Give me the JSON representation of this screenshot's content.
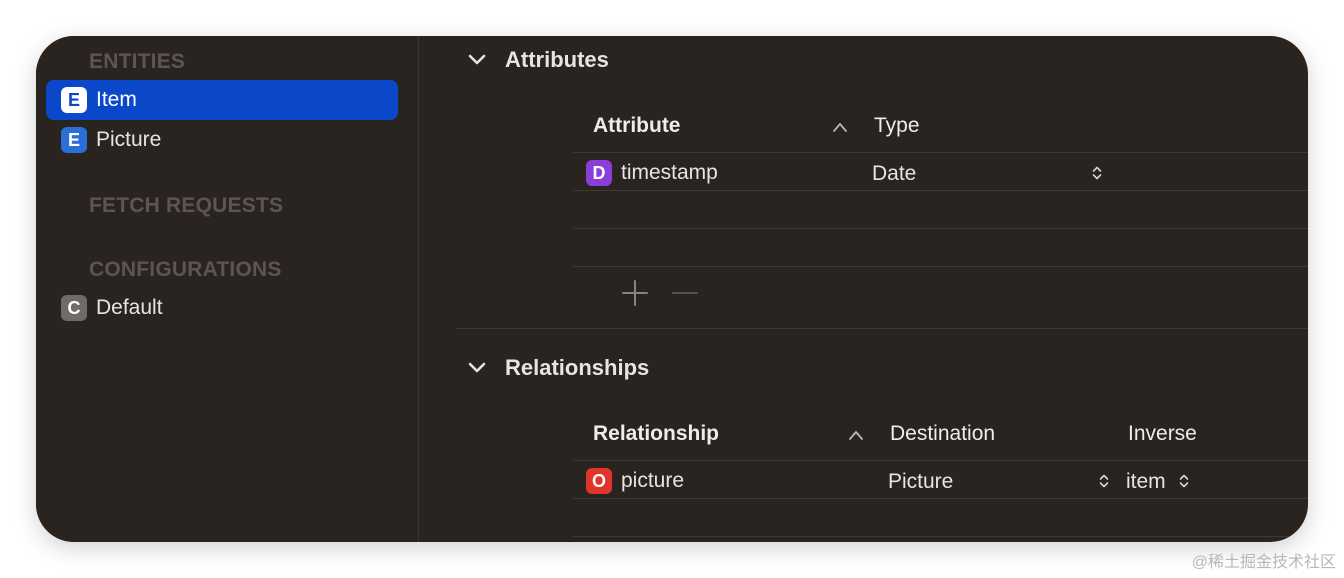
{
  "sidebar": {
    "entities_title": "ENTITIES",
    "entities": [
      {
        "badge": "E",
        "label": "Item",
        "selected": true
      },
      {
        "badge": "E",
        "label": "Picture",
        "selected": false
      }
    ],
    "fetch_requests_title": "FETCH REQUESTS",
    "configurations_title": "CONFIGURATIONS",
    "configurations": [
      {
        "badge": "C",
        "label": "Default"
      }
    ]
  },
  "attributes": {
    "title": "Attributes",
    "columns": {
      "attribute": "Attribute",
      "type": "Type"
    },
    "rows": [
      {
        "badge": "D",
        "name": "timestamp",
        "type": "Date"
      }
    ]
  },
  "relationships": {
    "title": "Relationships",
    "columns": {
      "relationship": "Relationship",
      "destination": "Destination",
      "inverse": "Inverse"
    },
    "rows": [
      {
        "badge": "O",
        "name": "picture",
        "destination": "Picture",
        "inverse": "item"
      }
    ]
  },
  "watermark": "@稀土掘金技术社区",
  "colors": {
    "window_bg": "#2a2420",
    "selection": "#0b48c9",
    "entity_badge": "#2b6fd6",
    "date_badge": "#8b3fd9",
    "relationship_badge": "#e0342c",
    "config_badge": "#6f6b69"
  },
  "icons": [
    "chevron-down-icon",
    "sort-up-icon",
    "stepper-icon",
    "plus-icon",
    "minus-icon"
  ]
}
